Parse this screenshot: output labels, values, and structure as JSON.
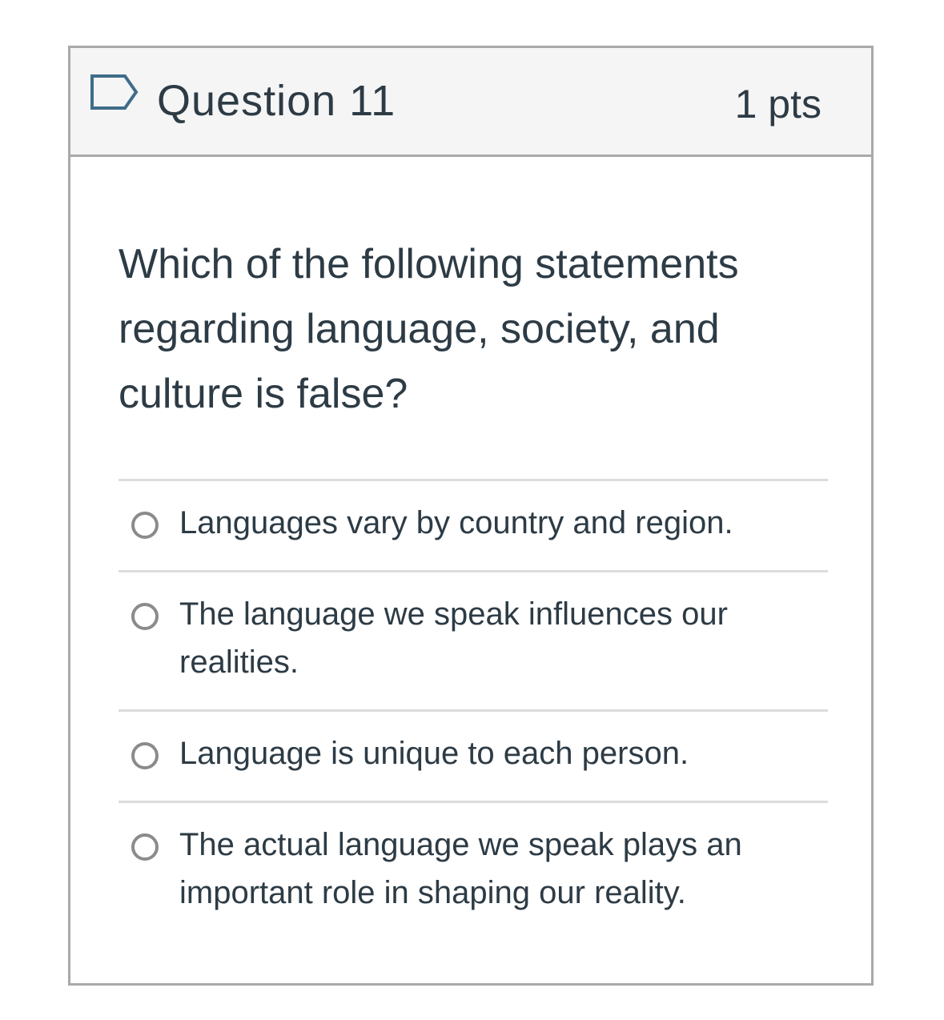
{
  "question": {
    "title": "Question 11",
    "points": "1 pts",
    "flag_icon": "flag-outline-icon",
    "text": "Which of the following statements regarding language, society, and culture is false?"
  },
  "answers": [
    {
      "label": "Languages vary by country and region.",
      "selected": false
    },
    {
      "label": "The language we speak influences our realities.",
      "selected": false
    },
    {
      "label": "Language is unique to each person.",
      "selected": false
    },
    {
      "label": "The actual language we speak plays an important role in shaping our reality.",
      "selected": false
    }
  ],
  "colors": {
    "text": "#2d3b45",
    "header_bg": "#f5f5f5",
    "border": "#a9a9a9",
    "divider": "#dcdcdc",
    "radio": "#8b8b8b",
    "flag": "#3f6d8a"
  }
}
